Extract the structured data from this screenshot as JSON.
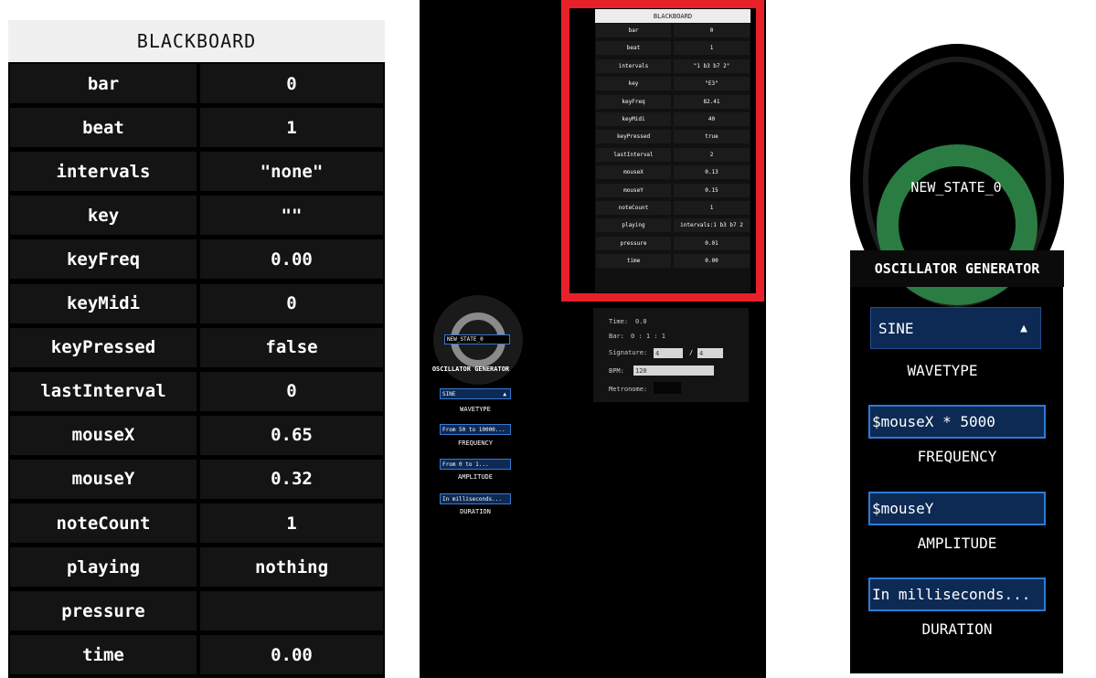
{
  "blackboard": {
    "title": "BLACKBOARD",
    "rows": [
      {
        "key": "bar",
        "value": "0"
      },
      {
        "key": "beat",
        "value": "1"
      },
      {
        "key": "intervals",
        "value": "\"none\""
      },
      {
        "key": "key",
        "value": "\"\""
      },
      {
        "key": "keyFreq",
        "value": "0.00"
      },
      {
        "key": "keyMidi",
        "value": "0"
      },
      {
        "key": "keyPressed",
        "value": "false"
      },
      {
        "key": "lastInterval",
        "value": "0"
      },
      {
        "key": "mouseX",
        "value": "0.65"
      },
      {
        "key": "mouseY",
        "value": "0.32"
      },
      {
        "key": "noteCount",
        "value": "1"
      },
      {
        "key": "playing",
        "value": "nothing"
      },
      {
        "key": "pressure",
        "value": ""
      },
      {
        "key": "time",
        "value": "0.00"
      }
    ]
  },
  "overview": {
    "blackboard_title": "BLACKBOARD",
    "rows": [
      {
        "key": "bar",
        "value": "0"
      },
      {
        "key": "beat",
        "value": "1"
      },
      {
        "key": "intervals",
        "value": "\"1 b3 b7 2\""
      },
      {
        "key": "key",
        "value": "\"E3\""
      },
      {
        "key": "keyFreq",
        "value": "82.41"
      },
      {
        "key": "keyMidi",
        "value": "40"
      },
      {
        "key": "keyPressed",
        "value": "true"
      },
      {
        "key": "lastInterval",
        "value": "2"
      },
      {
        "key": "mouseX",
        "value": "0.13"
      },
      {
        "key": "mouseY",
        "value": "0.15"
      },
      {
        "key": "noteCount",
        "value": "1"
      },
      {
        "key": "playing",
        "value": "intervals:1 b3 b7 2"
      },
      {
        "key": "pressure",
        "value": "0.01"
      },
      {
        "key": "time",
        "value": "0.00"
      }
    ],
    "transport": {
      "time_label": "Time:",
      "time_value": "0.0",
      "bar_label": "Bar:",
      "bar_value": "0 : 1 : 1",
      "signature_label": "Signature:",
      "sig_num": "4",
      "sig_sep": "/",
      "sig_den": "4",
      "bpm_label": "BPM:",
      "bpm_value": "120",
      "metronome_label": "Metronome:"
    },
    "oscillator": {
      "state_label": "NEW_STATE_0",
      "title": "OSCILLATOR GENERATOR",
      "wavetype_value": "SINE",
      "wavetype_label": "WAVETYPE",
      "frequency_value": "From 50 to 10000...",
      "frequency_label": "FREQUENCY",
      "amplitude_value": "From 0 to 1...",
      "amplitude_label": "AMPLITUDE",
      "duration_value": "In milliseconds...",
      "duration_label": "DURATION"
    },
    "highlight_color": "#e8202a"
  },
  "oscillator": {
    "state_label": "NEW_STATE_0",
    "title": "OSCILLATOR GENERATOR",
    "wavetype_value": "SINE",
    "wavetype_arrow": "▲",
    "wavetype_label": "WAVETYPE",
    "frequency_value": "$mouseX * 5000",
    "frequency_label": "FREQUENCY",
    "amplitude_value": "$mouseY",
    "amplitude_label": "AMPLITUDE",
    "duration_value": "In milliseconds...",
    "duration_label": "DURATION",
    "ring_color": "#2a7c43",
    "field_color": "#0d2a55"
  }
}
